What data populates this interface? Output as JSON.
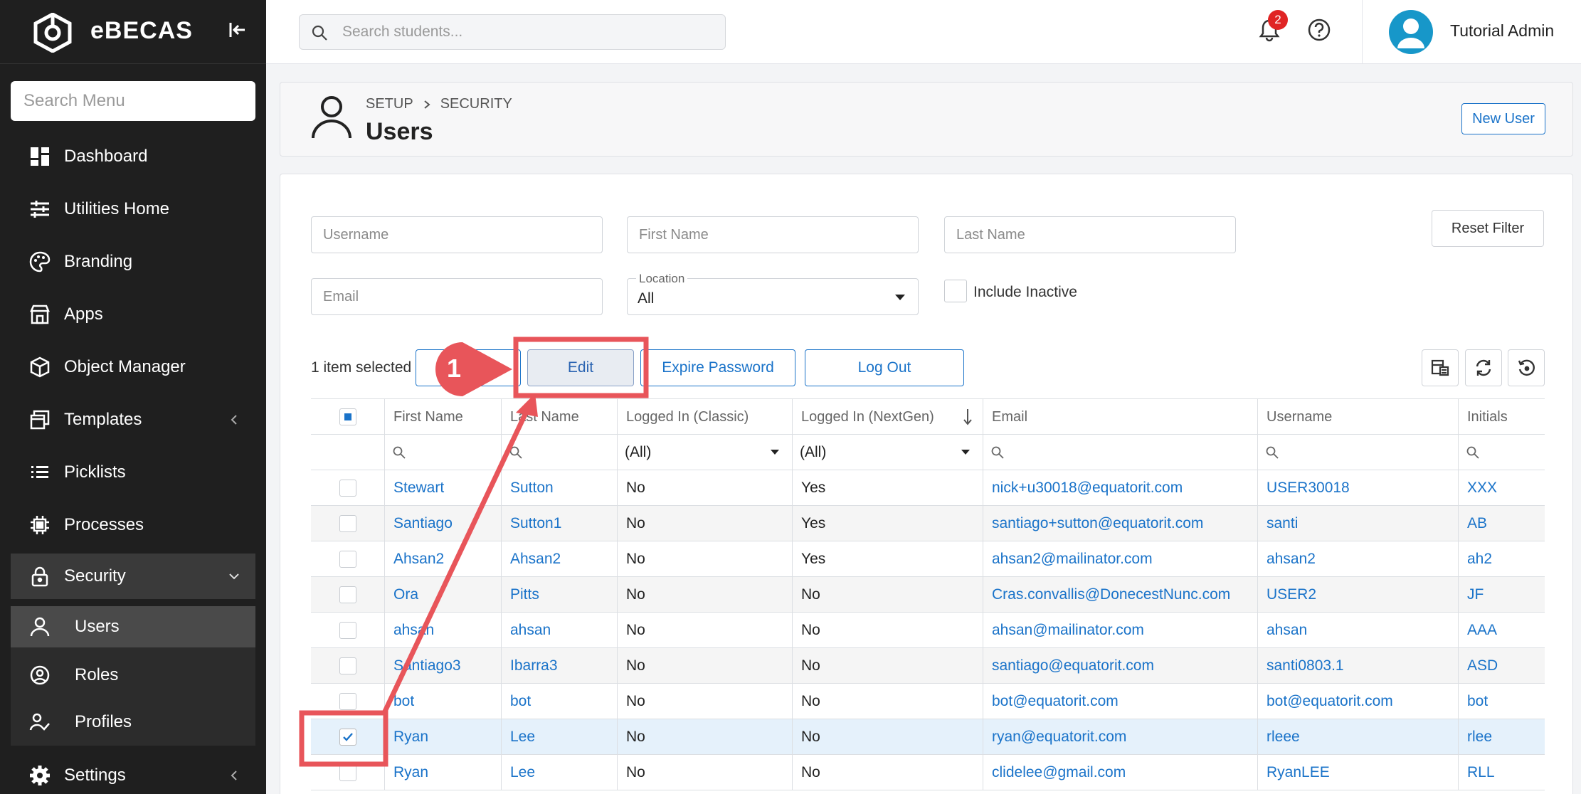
{
  "brand": {
    "name": "eBECAS"
  },
  "sidebar": {
    "search_placeholder": "Search Menu",
    "items": [
      {
        "label": "Dashboard",
        "icon": "dashboard-icon"
      },
      {
        "label": "Utilities Home",
        "icon": "sliders-icon"
      },
      {
        "label": "Branding",
        "icon": "palette-icon"
      },
      {
        "label": "Apps",
        "icon": "store-icon"
      },
      {
        "label": "Object Manager",
        "icon": "cube-icon"
      },
      {
        "label": "Templates",
        "icon": "window-icon"
      },
      {
        "label": "Picklists",
        "icon": "list-icon"
      },
      {
        "label": "Processes",
        "icon": "chip-icon"
      },
      {
        "label": "Security",
        "icon": "lock-icon"
      },
      {
        "label": "Settings",
        "icon": "gear-icon"
      }
    ],
    "security_sub": [
      {
        "label": "Users",
        "icon": "user-icon"
      },
      {
        "label": "Roles",
        "icon": "user-circle-icon"
      },
      {
        "label": "Profiles",
        "icon": "user-check-icon"
      }
    ]
  },
  "topbar": {
    "search_placeholder": "Search students...",
    "notification_count": "2",
    "user_name": "Tutorial Admin"
  },
  "page": {
    "breadcrumb": [
      "SETUP",
      "SECURITY"
    ],
    "title": "Users",
    "new_user_label": "New User"
  },
  "filters": {
    "username_placeholder": "Username",
    "first_name_placeholder": "First Name",
    "last_name_placeholder": "Last Name",
    "email_placeholder": "Email",
    "location_label": "Location",
    "location_value": "All",
    "include_inactive_label": "Include Inactive",
    "reset_label": "Reset Filter"
  },
  "toolbar": {
    "selected_text": "1 item selected",
    "edit_label": "Edit",
    "expire_label": "Expire Password",
    "logout_label": "Log Out"
  },
  "grid": {
    "columns": [
      "First Name",
      "Last Name",
      "Logged In (Classic)",
      "Logged In (NextGen)",
      "Email",
      "Username",
      "Initials"
    ],
    "filter_all": "(All)",
    "rows": [
      {
        "first": "Stewart",
        "last": "Sutton",
        "classic": "No",
        "nextgen": "Yes",
        "email": "nick+u30018@equatorit.com",
        "username": "USER30018",
        "initials": "XXX",
        "checked": false
      },
      {
        "first": "Santiago",
        "last": "Sutton1",
        "classic": "No",
        "nextgen": "Yes",
        "email": "santiago+sutton@equatorit.com",
        "username": "santi",
        "initials": "AB",
        "checked": false
      },
      {
        "first": "Ahsan2",
        "last": "Ahsan2",
        "classic": "No",
        "nextgen": "Yes",
        "email": "ahsan2@mailinator.com",
        "username": "ahsan2",
        "initials": "ah2",
        "checked": false
      },
      {
        "first": "Ora",
        "last": "Pitts",
        "classic": "No",
        "nextgen": "No",
        "email": "Cras.convallis@DonecestNunc.com",
        "username": "USER2",
        "initials": "JF",
        "checked": false
      },
      {
        "first": "ahsan",
        "last": "ahsan",
        "classic": "No",
        "nextgen": "No",
        "email": "ahsan@mailinator.com",
        "username": "ahsan",
        "initials": "AAA",
        "checked": false
      },
      {
        "first": "Santiago3",
        "last": "Ibarra3",
        "classic": "No",
        "nextgen": "No",
        "email": "santiago@equatorit.com",
        "username": "santi0803.1",
        "initials": "ASD",
        "checked": false
      },
      {
        "first": "bot",
        "last": "bot",
        "classic": "No",
        "nextgen": "No",
        "email": "bot@equatorit.com",
        "username": "bot@equatorit.com",
        "initials": "bot",
        "checked": false
      },
      {
        "first": "Ryan",
        "last": "Lee",
        "classic": "No",
        "nextgen": "No",
        "email": "ryan@equatorit.com",
        "username": "rleee",
        "initials": "rlee",
        "checked": true
      },
      {
        "first": "Ryan",
        "last": "Lee",
        "classic": "No",
        "nextgen": "No",
        "email": "clidelee@gmail.com",
        "username": "RyanLEE",
        "initials": "RLL",
        "checked": false
      }
    ]
  },
  "annotation": {
    "step_number": "1"
  },
  "colors": {
    "accent": "#1a73c9",
    "annotation": "#e8555a",
    "sidebar_bg": "#1f1f1f"
  }
}
